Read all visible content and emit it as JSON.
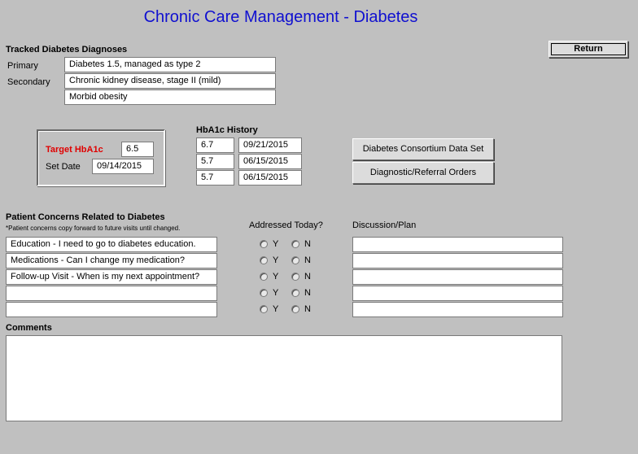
{
  "title": "Chronic Care Management - Diabetes",
  "return_label": "Return",
  "diagnoses": {
    "heading": "Tracked Diabetes Diagnoses",
    "primary_label": "Primary",
    "secondary_label": "Secondary",
    "values": [
      "Diabetes 1.5, managed as type 2",
      "Chronic kidney disease, stage II (mild)",
      "Morbid obesity"
    ]
  },
  "target": {
    "label": "Target HbA1c",
    "value": "6.5",
    "set_date_label": "Set Date",
    "set_date": "09/14/2015"
  },
  "history": {
    "heading": "HbA1c History",
    "rows": [
      {
        "value": "6.7",
        "date": "09/21/2015"
      },
      {
        "value": "5.7",
        "date": "06/15/2015"
      },
      {
        "value": "5.7",
        "date": "06/15/2015"
      }
    ]
  },
  "buttons": {
    "consortium": "Diabetes Consortium Data Set",
    "orders": "Diagnostic/Referral Orders"
  },
  "concerns": {
    "heading": "Patient Concerns Related to Diabetes",
    "note": "*Patient concerns copy forward to future visits until changed.",
    "addressed_heading": "Addressed Today?",
    "discussion_heading": "Discussion/Plan",
    "yes_label": "Y",
    "no_label": "N",
    "items": [
      "Education - I need to go to diabetes education.",
      "Medications - Can I change my medication?",
      "Follow-up Visit - When is my next appointment?",
      "",
      ""
    ]
  },
  "comments_heading": "Comments",
  "colors": {
    "background": "#c0c0c0",
    "title": "#1010d0",
    "target_label": "#e00000"
  }
}
